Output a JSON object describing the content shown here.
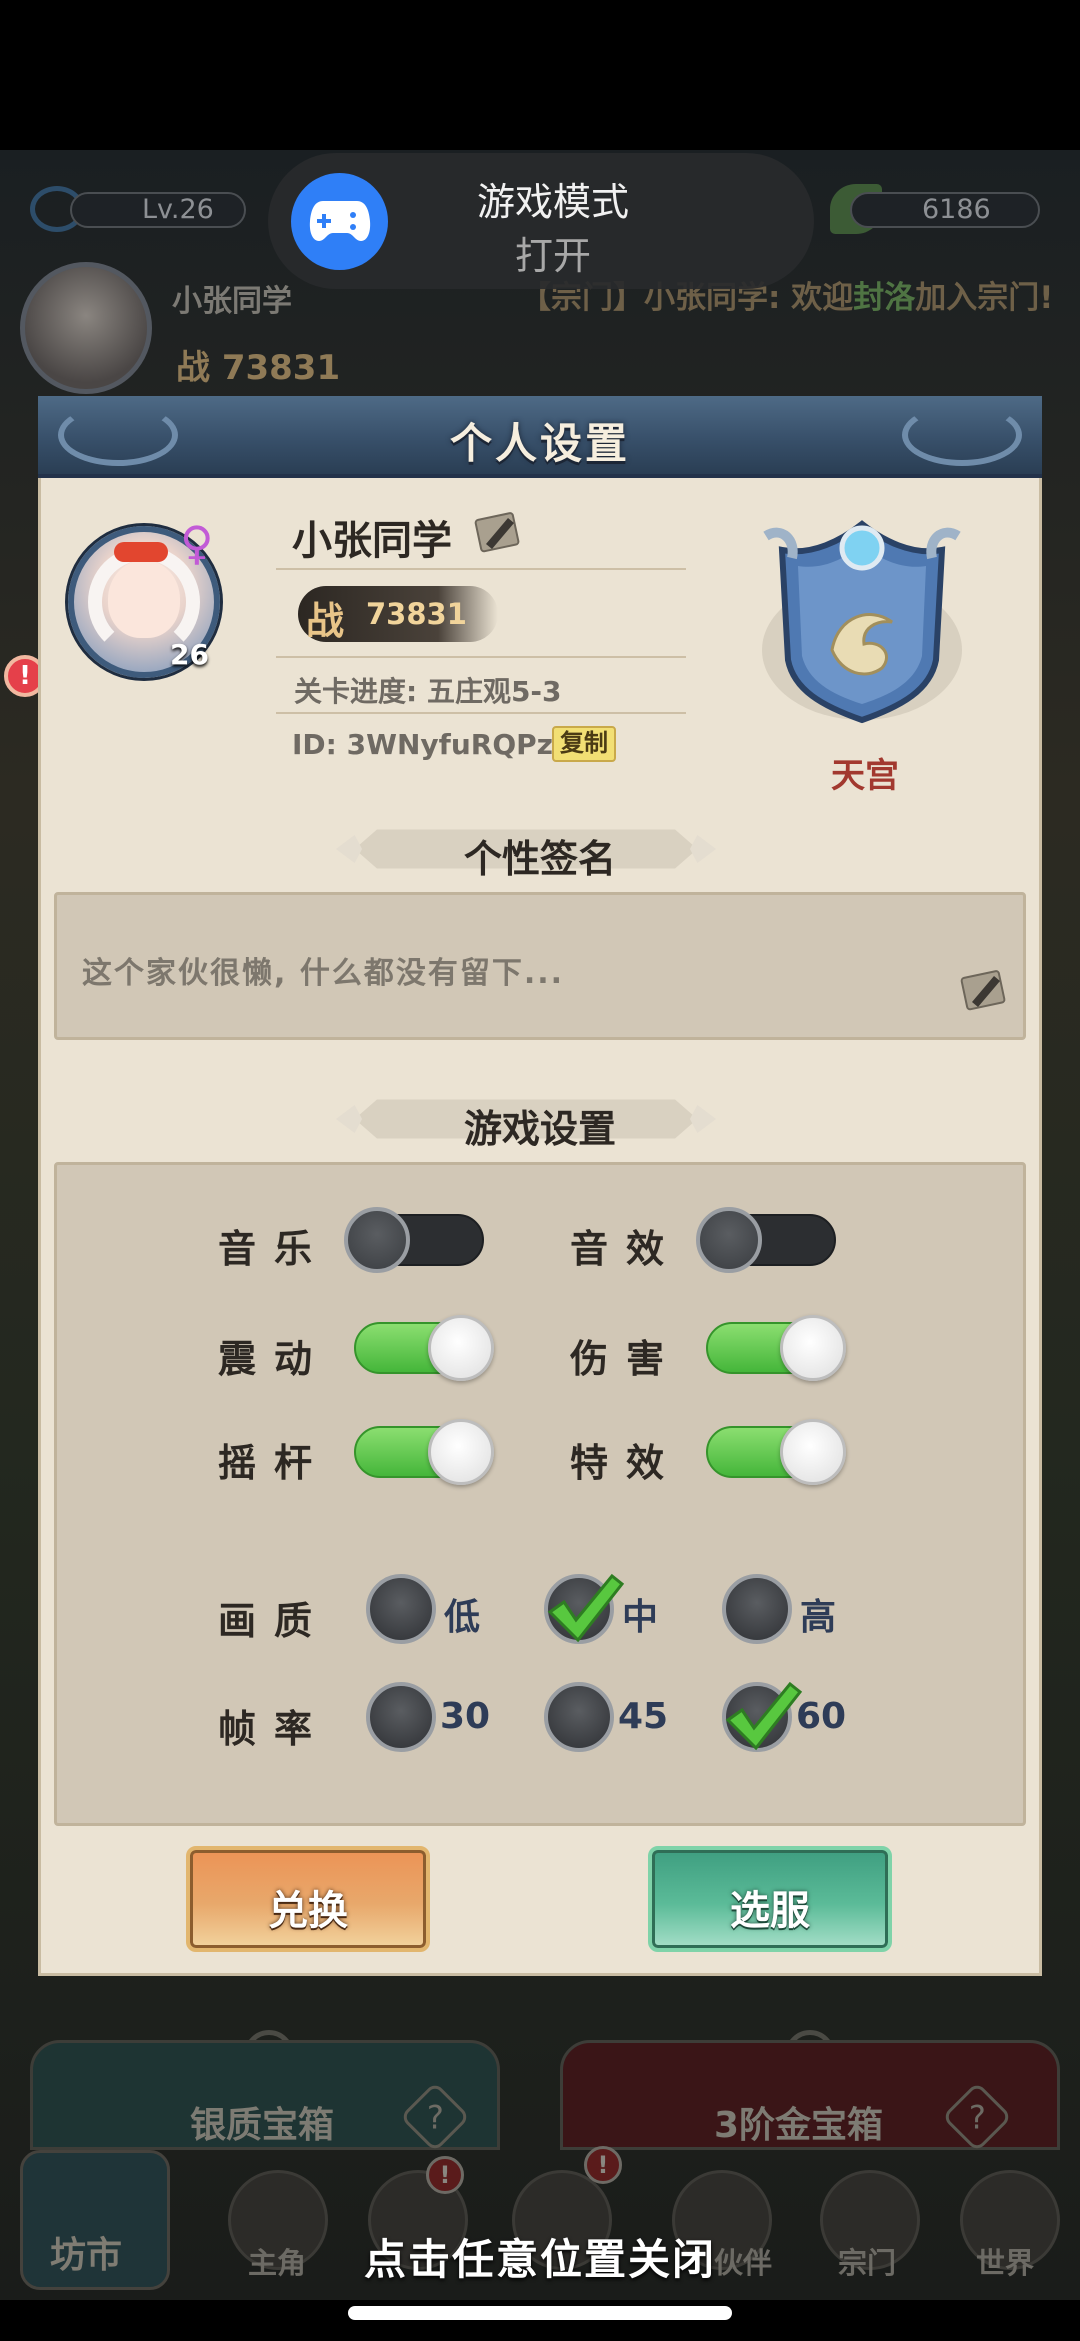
{
  "status_toast": {
    "title": "游戏模式",
    "subtitle": "打开",
    "icon": "gamepad-icon"
  },
  "background": {
    "level": "Lv.26",
    "coins": "6186",
    "player_name": "小张同学",
    "power": "战 73831",
    "message_prefix": "【宗门】小张同学: 欢迎",
    "message_highlight": "封洛",
    "message_suffix": "加入宗门!",
    "chest_left": "银质宝箱",
    "chest_right": "3阶金宝箱",
    "chest_help": "?",
    "shop": "坊市",
    "nav": [
      "主角",
      "伙伴",
      "宗门",
      "世界"
    ],
    "alert_mark": "!"
  },
  "dialog": {
    "title": "个人设置",
    "profile": {
      "name": "小张同学",
      "gender": "♀",
      "level": "26",
      "power_word": "战",
      "power_value": "73831",
      "stage": "关卡进度: 五庄观5-3",
      "uid": "ID: 3WNyfuRQPza",
      "copy_label": "复制",
      "rank": "天宫"
    },
    "signature": {
      "heading": "个性签名",
      "text": "这个家伙很懒, 什么都没有留下..."
    },
    "settings": {
      "heading": "游戏设置",
      "toggles": [
        {
          "label": "音乐",
          "on": false
        },
        {
          "label": "音效",
          "on": false
        },
        {
          "label": "震动",
          "on": true
        },
        {
          "label": "伤害",
          "on": true
        },
        {
          "label": "摇杆",
          "on": true
        },
        {
          "label": "特效",
          "on": true
        }
      ],
      "quality": {
        "label": "画质",
        "options": [
          "低",
          "中",
          "高"
        ],
        "selected": "中"
      },
      "framerate": {
        "label": "帧率",
        "options": [
          "30",
          "45",
          "60"
        ],
        "selected": "60"
      }
    },
    "buttons": {
      "exchange": "兑换",
      "server": "选服"
    }
  },
  "close_hint": "点击任意位置关闭",
  "colors": {
    "accent_green": "#45b63a",
    "dialog_bg": "#ebe3d3",
    "header_blue": "#38506a",
    "rank_red": "#a2392f"
  }
}
